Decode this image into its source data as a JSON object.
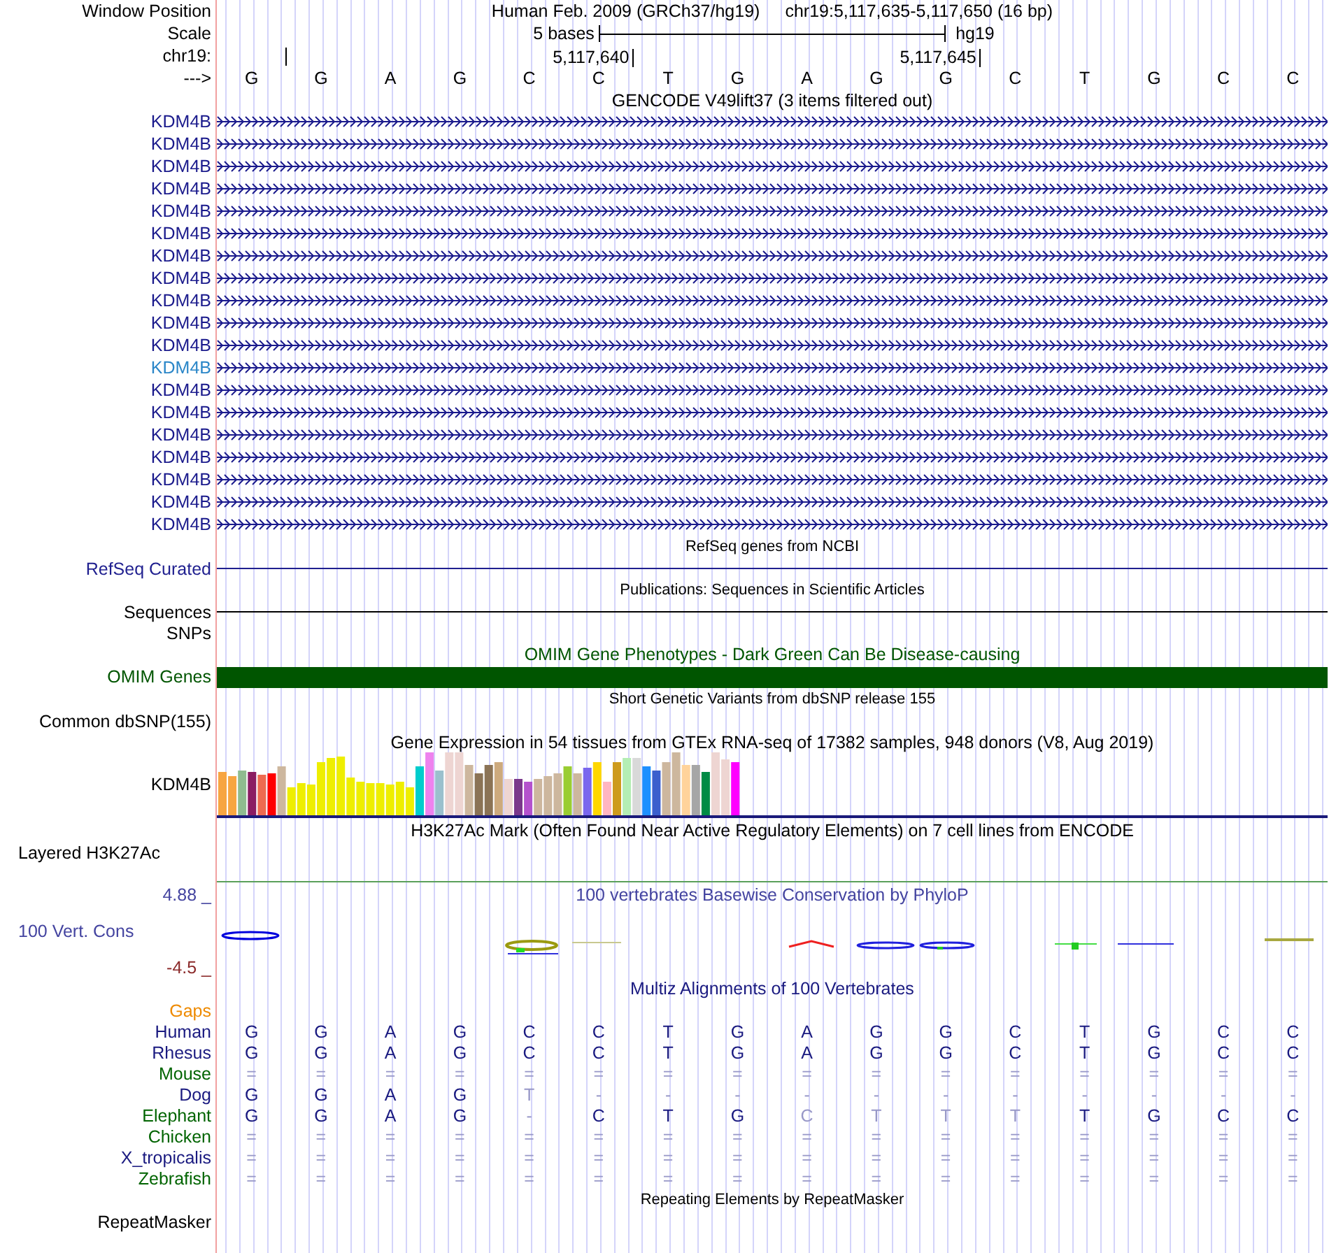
{
  "header": {
    "window_position_label": "Window Position",
    "assembly": "Human Feb. 2009 (GRCh37/hg19)",
    "position": "chr19:5,117,635-5,117,650 (16 bp)",
    "scale_label": "Scale",
    "scale_text": "5 bases",
    "scale_assembly": "hg19",
    "chrom_label": "chr19:",
    "ticks": [
      "5,117,640",
      "5,117,645"
    ],
    "strand_label": "--->",
    "bases": [
      "G",
      "G",
      "A",
      "G",
      "C",
      "C",
      "T",
      "G",
      "A",
      "G",
      "G",
      "C",
      "T",
      "G",
      "C",
      "C"
    ]
  },
  "tracks": [
    {
      "kind": "genes",
      "title": "GENCODE V49lift37 (3 items filtered out)",
      "items": [
        {
          "label": "KDM4B",
          "color": "#1a1a8c"
        },
        {
          "label": "KDM4B",
          "color": "#1a1a8c"
        },
        {
          "label": "KDM4B",
          "color": "#1a1a8c"
        },
        {
          "label": "KDM4B",
          "color": "#1a1a8c"
        },
        {
          "label": "KDM4B",
          "color": "#1a1a8c"
        },
        {
          "label": "KDM4B",
          "color": "#1a1a8c"
        },
        {
          "label": "KDM4B",
          "color": "#1a1a8c"
        },
        {
          "label": "KDM4B",
          "color": "#1a1a8c"
        },
        {
          "label": "KDM4B",
          "color": "#1a1a8c"
        },
        {
          "label": "KDM4B",
          "color": "#1a1a8c"
        },
        {
          "label": "KDM4B",
          "color": "#1a1a8c"
        },
        {
          "label": "KDM4B",
          "color": "#2a86c8"
        },
        {
          "label": "KDM4B",
          "color": "#1a1a8c"
        },
        {
          "label": "KDM4B",
          "color": "#1a1a8c"
        },
        {
          "label": "KDM4B",
          "color": "#1a1a8c"
        },
        {
          "label": "KDM4B",
          "color": "#1a1a8c"
        },
        {
          "label": "KDM4B",
          "color": "#1a1a8c"
        },
        {
          "label": "KDM4B",
          "color": "#1a1a8c"
        },
        {
          "label": "KDM4B",
          "color": "#1a1a8c"
        }
      ]
    },
    {
      "kind": "line",
      "title": "RefSeq genes from NCBI",
      "label": "RefSeq Curated",
      "color": "#1f1f8f"
    },
    {
      "kind": "line",
      "title": "Publications: Sequences in Scientific Articles",
      "label": "Sequences",
      "color": "#000000"
    },
    {
      "kind": "plain",
      "label": "SNPs",
      "color": "#000000"
    },
    {
      "kind": "bar",
      "title": "OMIM Gene Phenotypes - Dark Green Can Be Disease-causing",
      "label": "OMIM Genes",
      "color": "#005500"
    },
    {
      "kind": "plain",
      "title": "Short Genetic Variants from dbSNP release 155",
      "label": "Common dbSNP(155)",
      "color": "#000000"
    },
    {
      "kind": "expression",
      "title": "Gene Expression in 54 tissues from GTEx RNA-seq of 17382 samples, 948 donors (V8, Aug 2019)",
      "label": "KDM4B",
      "color": "#1a1a7a"
    },
    {
      "kind": "layered",
      "title": "H3K27Ac Mark (Often Found Near Active Regulatory Elements) on 7 cell lines from ENCODE",
      "label": "Layered H3K27Ac",
      "color": "#5aa05a"
    },
    {
      "kind": "conservation",
      "title": "100 vertebrates Basewise Conservation by PhyloP",
      "label": "100 Vert. Cons",
      "max": "4.88 _",
      "min": "-4.5 _",
      "color": "#4444a0"
    },
    {
      "kind": "alignment",
      "title": "Multiz Alignments of 100 Vertebrates",
      "color": "#1a1a80",
      "rows": [
        {
          "label": "Gaps",
          "color": "#ee8a00"
        },
        {
          "label": "Human",
          "color": "#1a1a80",
          "bases": [
            {
              "text": "G",
              "faded": false
            },
            {
              "text": "G",
              "faded": false
            },
            {
              "text": "A",
              "faded": false
            },
            {
              "text": "G",
              "faded": false
            },
            {
              "text": "C",
              "faded": false
            },
            {
              "text": "C",
              "faded": false
            },
            {
              "text": "T",
              "faded": false
            },
            {
              "text": "G",
              "faded": false
            },
            {
              "text": "A",
              "faded": false
            },
            {
              "text": "G",
              "faded": false
            },
            {
              "text": "G",
              "faded": false
            },
            {
              "text": "C",
              "faded": false
            },
            {
              "text": "T",
              "faded": false
            },
            {
              "text": "G",
              "faded": false
            },
            {
              "text": "C",
              "faded": false
            },
            {
              "text": "C",
              "faded": false
            }
          ]
        },
        {
          "label": "Rhesus",
          "color": "#1a1a80",
          "bases": [
            {
              "text": "G",
              "faded": false
            },
            {
              "text": "G",
              "faded": false
            },
            {
              "text": "A",
              "faded": false
            },
            {
              "text": "G",
              "faded": false
            },
            {
              "text": "C",
              "faded": false
            },
            {
              "text": "C",
              "faded": false
            },
            {
              "text": "T",
              "faded": false
            },
            {
              "text": "G",
              "faded": false
            },
            {
              "text": "A",
              "faded": false
            },
            {
              "text": "G",
              "faded": false
            },
            {
              "text": "G",
              "faded": false
            },
            {
              "text": "C",
              "faded": false
            },
            {
              "text": "T",
              "faded": false
            },
            {
              "text": "G",
              "faded": false
            },
            {
              "text": "C",
              "faded": false
            },
            {
              "text": "C",
              "faded": false
            }
          ]
        },
        {
          "label": "Mouse",
          "color": "#006400",
          "bases": [
            {
              "text": "=",
              "faded": true
            },
            {
              "text": "=",
              "faded": true
            },
            {
              "text": "=",
              "faded": true
            },
            {
              "text": "=",
              "faded": true
            },
            {
              "text": "=",
              "faded": true
            },
            {
              "text": "=",
              "faded": true
            },
            {
              "text": "=",
              "faded": true
            },
            {
              "text": "=",
              "faded": true
            },
            {
              "text": "=",
              "faded": true
            },
            {
              "text": "=",
              "faded": true
            },
            {
              "text": "=",
              "faded": true
            },
            {
              "text": "=",
              "faded": true
            },
            {
              "text": "=",
              "faded": true
            },
            {
              "text": "=",
              "faded": true
            },
            {
              "text": "=",
              "faded": true
            },
            {
              "text": "=",
              "faded": true
            }
          ]
        },
        {
          "label": "Dog",
          "color": "#1a1a80",
          "bases": [
            {
              "text": "G",
              "faded": false
            },
            {
              "text": "G",
              "faded": false
            },
            {
              "text": "A",
              "faded": false
            },
            {
              "text": "G",
              "faded": false
            },
            {
              "text": "T",
              "faded": true
            },
            {
              "text": "-",
              "faded": true
            },
            {
              "text": "-",
              "faded": true
            },
            {
              "text": "-",
              "faded": true
            },
            {
              "text": "-",
              "faded": true
            },
            {
              "text": "-",
              "faded": true
            },
            {
              "text": "-",
              "faded": true
            },
            {
              "text": "-",
              "faded": true
            },
            {
              "text": "-",
              "faded": true
            },
            {
              "text": "-",
              "faded": true
            },
            {
              "text": "-",
              "faded": true
            },
            {
              "text": "-",
              "faded": true
            }
          ]
        },
        {
          "label": "Elephant",
          "color": "#006400",
          "bases": [
            {
              "text": "G",
              "faded": false
            },
            {
              "text": "G",
              "faded": false
            },
            {
              "text": "A",
              "faded": false
            },
            {
              "text": "G",
              "faded": false
            },
            {
              "text": "-",
              "faded": true
            },
            {
              "text": "C",
              "faded": false
            },
            {
              "text": "T",
              "faded": false
            },
            {
              "text": "G",
              "faded": false
            },
            {
              "text": "C",
              "faded": true
            },
            {
              "text": "T",
              "faded": true
            },
            {
              "text": "T",
              "faded": true
            },
            {
              "text": "T",
              "faded": true
            },
            {
              "text": "T",
              "faded": false
            },
            {
              "text": "G",
              "faded": false
            },
            {
              "text": "C",
              "faded": false
            },
            {
              "text": "C",
              "faded": false
            }
          ]
        },
        {
          "label": "Chicken",
          "color": "#006400",
          "bases": [
            {
              "text": "=",
              "faded": true
            },
            {
              "text": "=",
              "faded": true
            },
            {
              "text": "=",
              "faded": true
            },
            {
              "text": "=",
              "faded": true
            },
            {
              "text": "=",
              "faded": true
            },
            {
              "text": "=",
              "faded": true
            },
            {
              "text": "=",
              "faded": true
            },
            {
              "text": "=",
              "faded": true
            },
            {
              "text": "=",
              "faded": true
            },
            {
              "text": "=",
              "faded": true
            },
            {
              "text": "=",
              "faded": true
            },
            {
              "text": "=",
              "faded": true
            },
            {
              "text": "=",
              "faded": true
            },
            {
              "text": "=",
              "faded": true
            },
            {
              "text": "=",
              "faded": true
            },
            {
              "text": "=",
              "faded": true
            }
          ]
        },
        {
          "label": "X_tropicalis",
          "color": "#1a1a80",
          "bases": [
            {
              "text": "=",
              "faded": true
            },
            {
              "text": "=",
              "faded": true
            },
            {
              "text": "=",
              "faded": true
            },
            {
              "text": "=",
              "faded": true
            },
            {
              "text": "=",
              "faded": true
            },
            {
              "text": "=",
              "faded": true
            },
            {
              "text": "=",
              "faded": true
            },
            {
              "text": "=",
              "faded": true
            },
            {
              "text": "=",
              "faded": true
            },
            {
              "text": "=",
              "faded": true
            },
            {
              "text": "=",
              "faded": true
            },
            {
              "text": "=",
              "faded": true
            },
            {
              "text": "=",
              "faded": true
            },
            {
              "text": "=",
              "faded": true
            },
            {
              "text": "=",
              "faded": true
            },
            {
              "text": "=",
              "faded": true
            }
          ]
        },
        {
          "label": "Zebrafish",
          "color": "#006400",
          "bases": [
            {
              "text": "=",
              "faded": true
            },
            {
              "text": "=",
              "faded": true
            },
            {
              "text": "=",
              "faded": true
            },
            {
              "text": "=",
              "faded": true
            },
            {
              "text": "=",
              "faded": true
            },
            {
              "text": "=",
              "faded": true
            },
            {
              "text": "=",
              "faded": true
            },
            {
              "text": "=",
              "faded": true
            },
            {
              "text": "=",
              "faded": true
            },
            {
              "text": "=",
              "faded": true
            },
            {
              "text": "=",
              "faded": true
            },
            {
              "text": "=",
              "faded": true
            },
            {
              "text": "=",
              "faded": true
            },
            {
              "text": "=",
              "faded": true
            },
            {
              "text": "=",
              "faded": true
            },
            {
              "text": "=",
              "faded": true
            }
          ]
        }
      ]
    },
    {
      "kind": "plain",
      "title": "Repeating Elements by RepeatMasker",
      "label": "RepeatMasker",
      "color": "#000000"
    }
  ]
}
